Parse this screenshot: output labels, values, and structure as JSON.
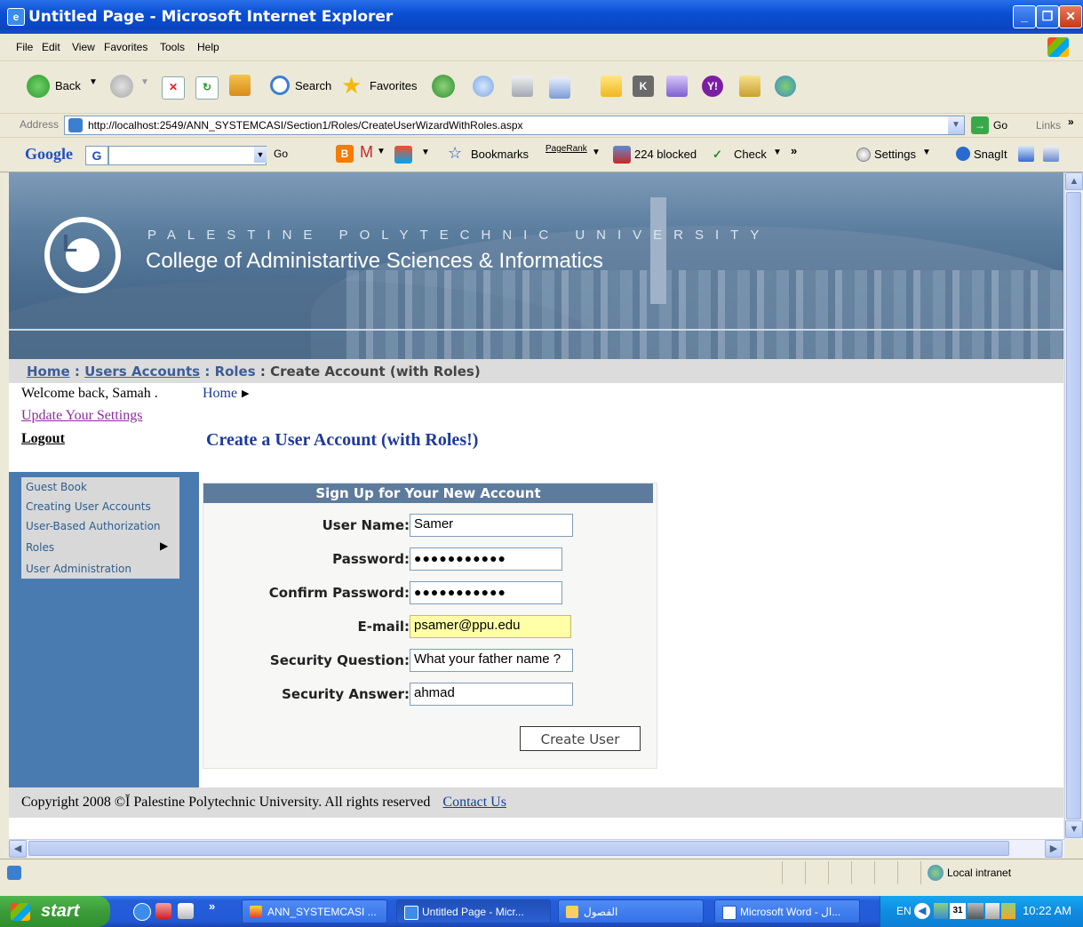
{
  "window": {
    "title": "Untitled Page - Microsoft Internet Explorer",
    "buttons": [
      "minimize",
      "maximize",
      "close"
    ]
  },
  "menubar": [
    "File",
    "Edit",
    "View",
    "Favorites",
    "Tools",
    "Help"
  ],
  "toolbar": {
    "back": "Back",
    "search": "Search",
    "favorites": "Favorites"
  },
  "address": {
    "label": "Address",
    "url": "http://localhost:2549/ANN_SYSTEMCASI/Section1/Roles/CreateUserWizardWithRoles.aspx",
    "go": "Go",
    "links": "Links"
  },
  "googlebar": {
    "brand": "Google",
    "go": "Go",
    "bookmarks": "Bookmarks",
    "pagerank": "PageRank",
    "blocked": "224 blocked",
    "check": "Check",
    "settings": "Settings",
    "snagit": "SnagIt"
  },
  "banner": {
    "university": "PALESTINE POLYTECHNIC UNIVERSITY",
    "college": "College of Administartive Sciences & Informatics"
  },
  "breadcrumb": {
    "home": "Home",
    "sep1": " : ",
    "users": "Users Accounts",
    "sep2": " : ",
    "roles": "Roles",
    "sep3": " : ",
    "current": "Create Account (with Roles)"
  },
  "sidebar": {
    "welcome": "Welcome back, Samah .",
    "update": "Update Your Settings",
    "logout": "Logout",
    "menu": [
      "Guest Book",
      "Creating User Accounts",
      "User-Based Authorization",
      "Roles",
      "User Administration"
    ]
  },
  "main": {
    "home_link": "Home",
    "title": "Create a User Account (with Roles!)",
    "form": {
      "header": "Sign Up for Your New Account",
      "fields": [
        {
          "label": "User Name:",
          "value": "Samer"
        },
        {
          "label": "Password:",
          "value": "●●●●●●●●●●●"
        },
        {
          "label": "Confirm Password:",
          "value": "●●●●●●●●●●●"
        },
        {
          "label": "E-mail:",
          "value": "psamer@ppu.edu"
        },
        {
          "label": "Security Question:",
          "value": "What your father name ?"
        },
        {
          "label": "Security Answer:",
          "value": "ahmad"
        }
      ],
      "submit": "Create User"
    }
  },
  "footer": {
    "copyright": "Copyright 2008 ©Ĭ Palestine Polytechnic University. All rights reserved",
    "contact": "Contact Us"
  },
  "statusbar": {
    "zone": "Local intranet"
  },
  "taskbar": {
    "start": "start",
    "tasks": [
      "ANN_SYSTEMCASI ...",
      "Untitled Page - Micr...",
      "الفصول",
      "Microsoft Word - ال..."
    ],
    "lang": "EN",
    "clock": "10:22 AM"
  },
  "colors": {
    "titlebar": "#0a4fd4",
    "side_menu": "#4a7bb0",
    "form_header": "#5d7b9d",
    "email_highlight": "#ffffa8",
    "link": "#1b3b99"
  }
}
